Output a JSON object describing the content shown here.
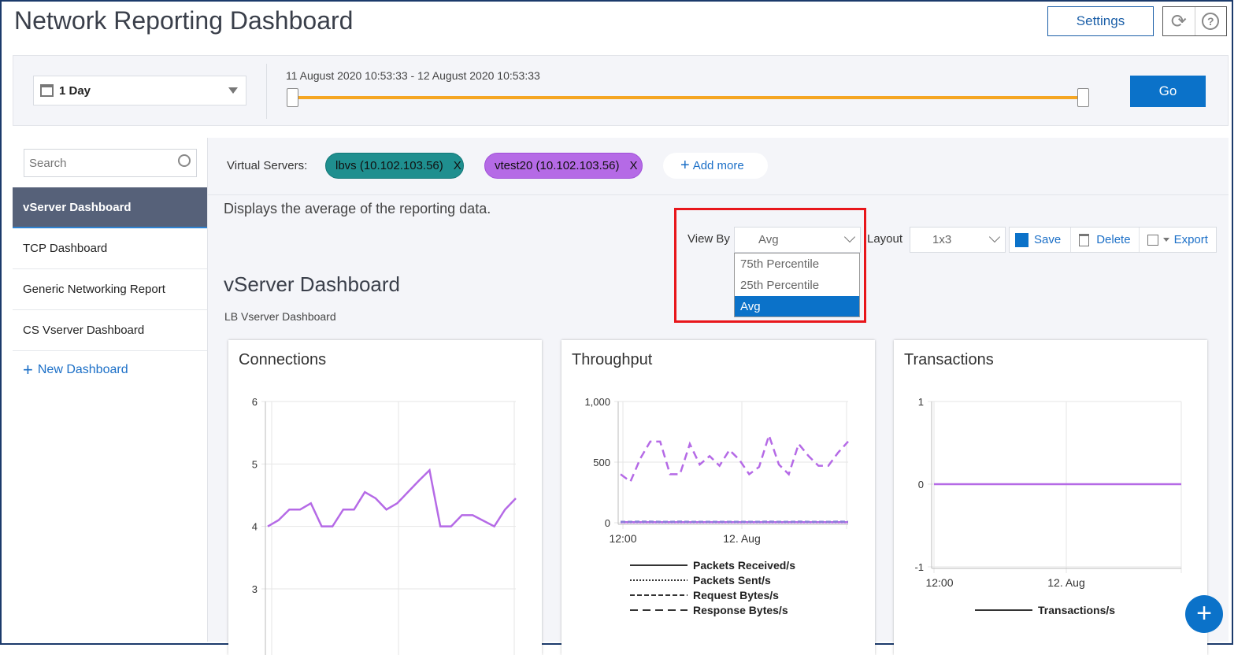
{
  "header": {
    "title": "Network Reporting Dashboard",
    "settings_label": "Settings",
    "refresh_icon": "refresh-icon",
    "help_icon": "help-icon"
  },
  "filter": {
    "range_label": "1 Day",
    "date_range": "11 August 2020 10:53:33 - 12 August 2020 10:53:33",
    "go_label": "Go",
    "slider_start": 0,
    "slider_end": 1,
    "accent": "#f5a623"
  },
  "sidebar": {
    "search_placeholder": "Search",
    "items": [
      {
        "label": "vServer Dashboard",
        "active": true
      },
      {
        "label": "TCP Dashboard"
      },
      {
        "label": "Generic Networking Report"
      },
      {
        "label": "CS Vserver Dashboard"
      }
    ],
    "new_dashboard": "New Dashboard"
  },
  "main": {
    "virtual_servers_label": "Virtual Servers:",
    "chips": [
      {
        "label": "lbvs (10.102.103.56)",
        "remove": "X",
        "color": "#1f8f8f"
      },
      {
        "label": "vtest20 (10.102.103.56)",
        "remove": "X",
        "color": "#b56ae6"
      }
    ],
    "add_more": "Add more",
    "description": "Displays the average of the reporting data.",
    "view_by_label": "View By",
    "view_by_value": "Avg",
    "view_by_options": [
      "75th Percentile",
      "25th Percentile",
      "Avg"
    ],
    "layout_label": "Layout",
    "layout_value": "1x3",
    "save": "Save",
    "delete": "Delete",
    "export": "Export",
    "dashboard_title": "vServer Dashboard",
    "dashboard_subtitle": "LB Vserver Dashboard"
  },
  "chart_data": [
    {
      "type": "line",
      "title": "Connections",
      "yticks": [
        "3",
        "4",
        "5",
        "6"
      ],
      "ylim": [
        3,
        6
      ],
      "grid": true,
      "series": [
        {
          "color": "#b56ae6",
          "values": [
            4.0,
            4.1,
            4.27,
            4.27,
            4.37,
            4.0,
            4.0,
            4.27,
            4.27,
            4.55,
            4.45,
            4.27,
            4.37,
            4.55,
            4.73,
            4.9,
            4.0,
            4.0,
            4.18,
            4.18,
            4.09,
            4.0,
            4.27,
            4.45
          ]
        }
      ]
    },
    {
      "type": "line",
      "title": "Throughput",
      "yticks": [
        "0",
        "500",
        "1,000"
      ],
      "ylim": [
        0,
        1000
      ],
      "xticks": [
        "12:00",
        "12. Aug"
      ],
      "grid": true,
      "series": [
        {
          "name": "Packets Received/s",
          "dash": "none",
          "color": "#b56ae6",
          "values": [
            5,
            5,
            5,
            5,
            5,
            5,
            5,
            5,
            5,
            5,
            5,
            5,
            5,
            5,
            5,
            5,
            5,
            5,
            5,
            5,
            5,
            5,
            5,
            5
          ]
        },
        {
          "name": "Packets Sent/s",
          "dash": "dotted",
          "color": "#b56ae6",
          "values": [
            3,
            3,
            3,
            3,
            3,
            3,
            3,
            3,
            3,
            3,
            3,
            3,
            3,
            3,
            3,
            3,
            3,
            3,
            3,
            3,
            3,
            3,
            3,
            3
          ]
        },
        {
          "name": "Request Bytes/s",
          "dash": "short-dash",
          "color": "#8a7fd8",
          "values": [
            8,
            8,
            10,
            10,
            8,
            8,
            10,
            8,
            8,
            8,
            8,
            8,
            8,
            8,
            8,
            10,
            8,
            8,
            10,
            8,
            8,
            8,
            10,
            8
          ]
        },
        {
          "name": "Response Bytes/s",
          "dash": "long-dash",
          "color": "#b56ae6",
          "values": [
            400,
            340,
            530,
            670,
            670,
            400,
            400,
            650,
            480,
            550,
            470,
            600,
            520,
            400,
            460,
            720,
            480,
            400,
            650,
            550,
            470,
            470,
            580,
            670
          ]
        }
      ]
    },
    {
      "type": "line",
      "title": "Transactions",
      "yticks": [
        "-1",
        "0",
        "1"
      ],
      "ylim": [
        -1,
        1
      ],
      "xticks": [
        "12:00",
        "12. Aug"
      ],
      "grid": true,
      "series": [
        {
          "name": "Transactions/s",
          "color": "#b56ae6",
          "values": [
            0,
            0
          ]
        }
      ]
    }
  ],
  "fab": {
    "icon": "plus-icon",
    "color": "#0b72c9"
  }
}
